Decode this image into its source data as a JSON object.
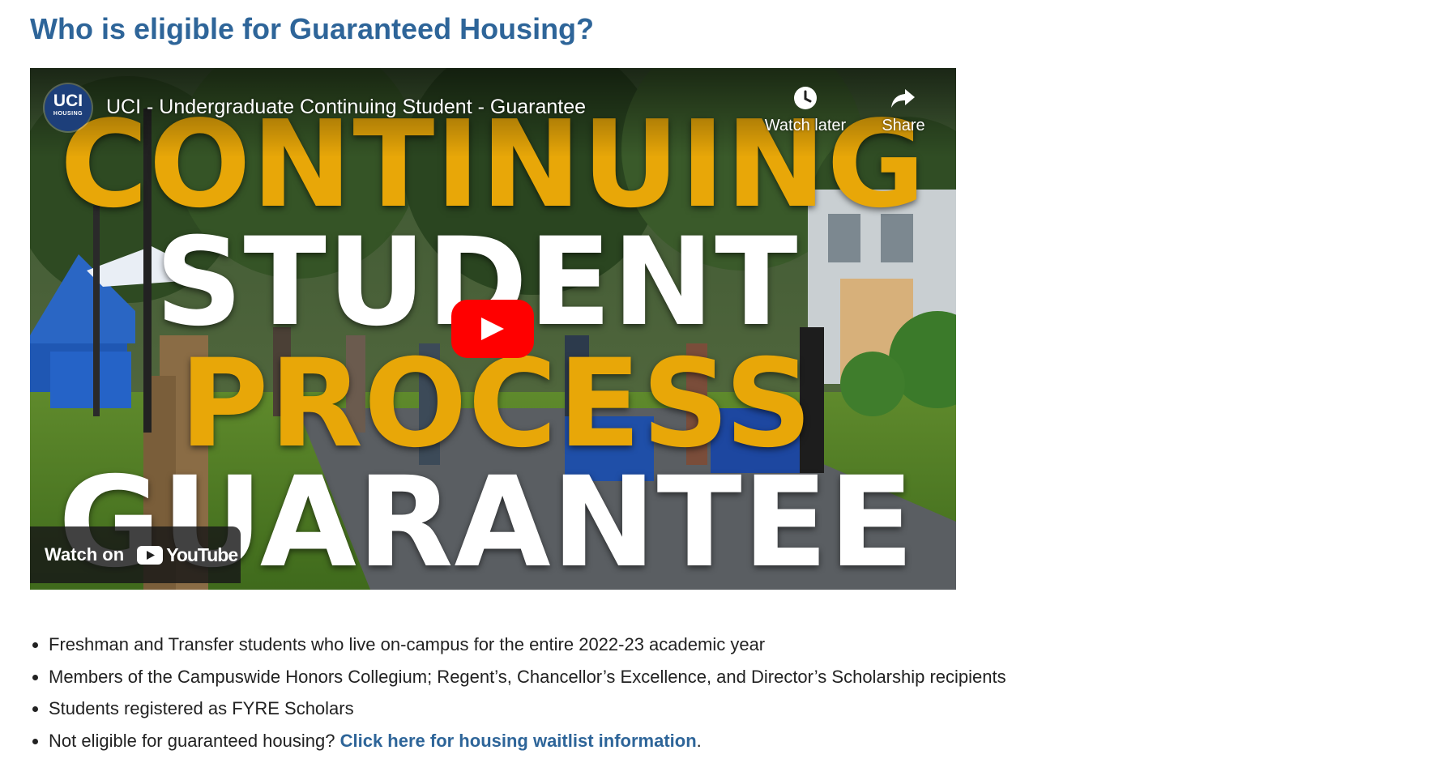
{
  "heading": "Who is eligible for Guaranteed Housing?",
  "video": {
    "channel_logo_text": "UCI",
    "channel_logo_subtext": "HOUSING",
    "title": "UCI - Undergraduate Continuing Student - Guarantee",
    "watch_later_label": "Watch later",
    "share_label": "Share",
    "thumbnail_lines": [
      "CONTINUING",
      "STUDENT",
      "PROCESS",
      "GUARANTEE"
    ],
    "watch_on_label": "Watch on",
    "youtube_label": "YouTube",
    "icons": {
      "play": "play-icon",
      "watch_later": "clock-icon",
      "share": "share-arrow-icon",
      "youtube": "youtube-logo-icon"
    }
  },
  "eligibility": [
    "Freshman and Transfer students who live on-campus for the entire 2022-23 academic year",
    "Members of the Campuswide Honors Collegium; Regent’s, Chancellor’s Excellence, and Director’s Scholarship recipients",
    "Students registered as FYRE Scholars"
  ],
  "last_item": {
    "prefix": "Not eligible for guaranteed housing? ",
    "link_text": "Click here for housing waitlist information",
    "suffix": "."
  },
  "colors": {
    "heading": "#2e6599",
    "link": "#2e6599",
    "thumbnail_gold": "#e8a708",
    "play_red": "#ff0000"
  }
}
